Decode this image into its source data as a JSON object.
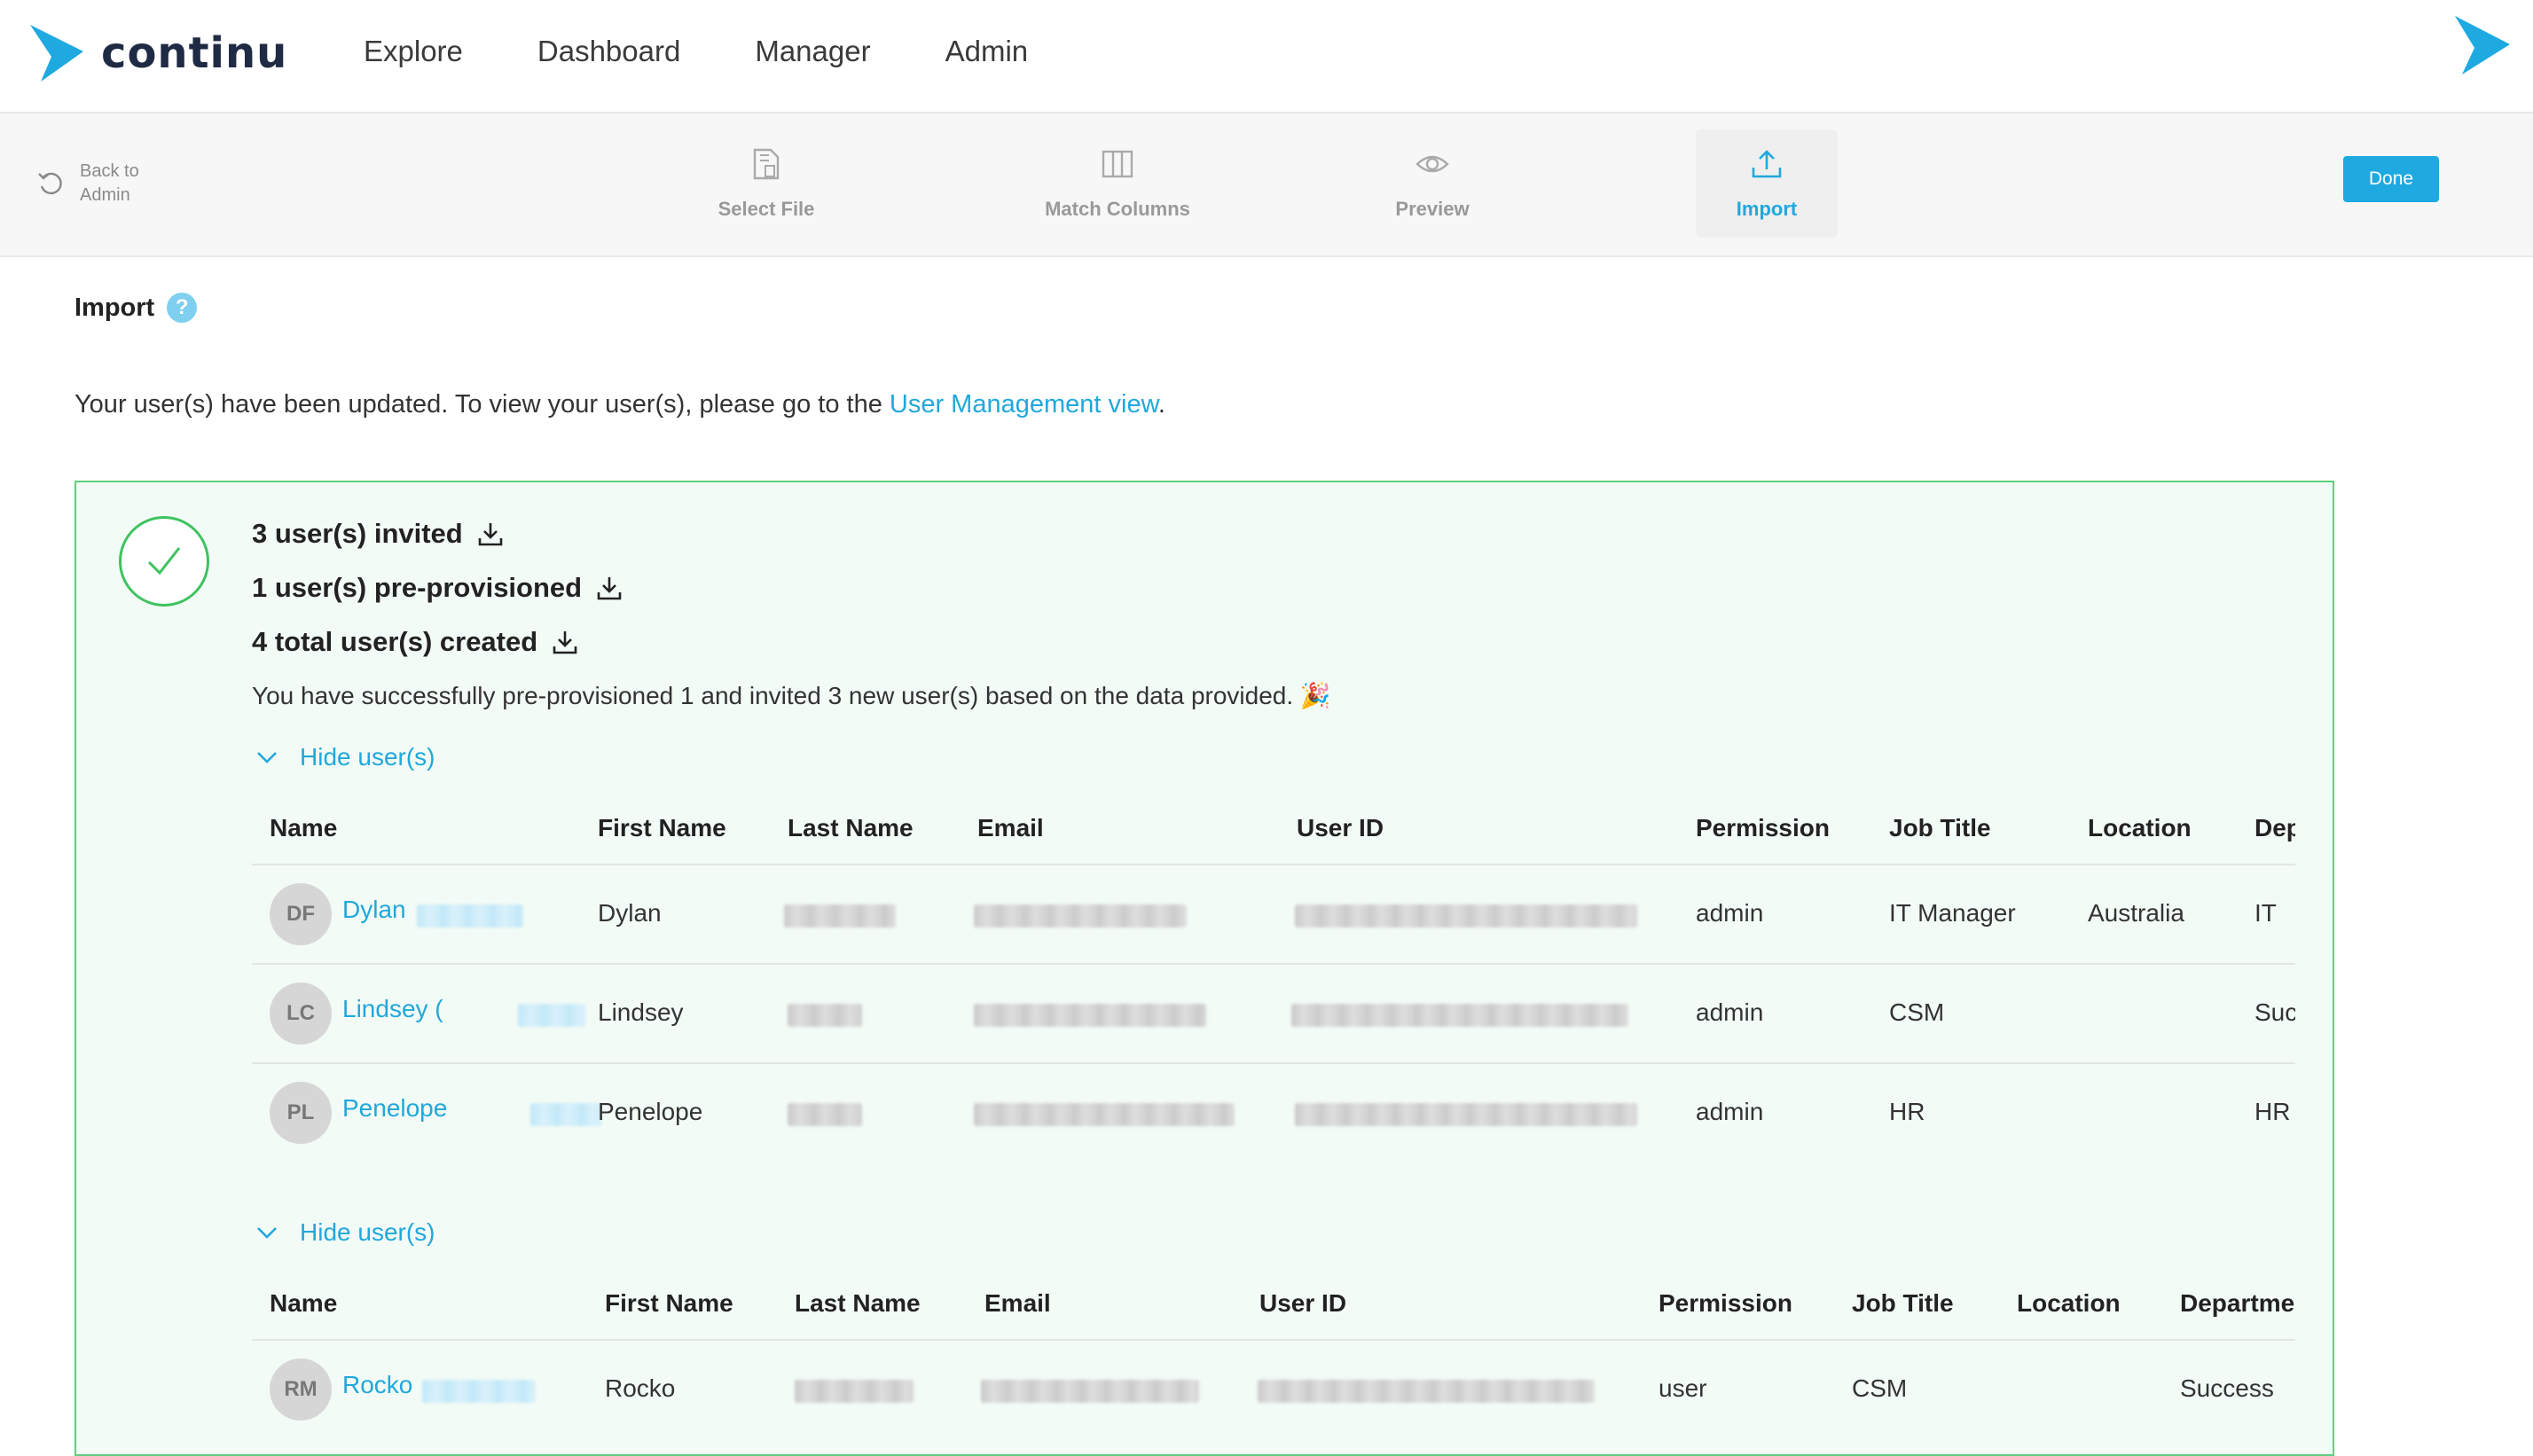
{
  "brand": {
    "name": "continu",
    "accent": "#1ea9e1"
  },
  "nav": {
    "items": [
      "Explore",
      "Dashboard",
      "Manager",
      "Admin"
    ]
  },
  "wizard": {
    "back_label": "Back to Admin",
    "steps": [
      {
        "label": "Select File",
        "icon": "file-icon"
      },
      {
        "label": "Match Columns",
        "icon": "columns-icon"
      },
      {
        "label": "Preview",
        "icon": "eye-icon"
      },
      {
        "label": "Import",
        "icon": "upload-icon",
        "active": true
      }
    ],
    "done_label": "Done"
  },
  "page": {
    "title": "Import",
    "help": "?",
    "info_prefix": "Your user(s) have been updated. To view your user(s), please go to the ",
    "info_link": "User Management view",
    "info_suffix": "."
  },
  "result": {
    "invited": "3 user(s) invited",
    "preprovisioned": "1 user(s) pre-provisioned",
    "total": "4 total user(s) created",
    "message": "You have successfully pre-provisioned 1 and invited 3 new user(s) based on the data provided. 🎉",
    "hide_label": "Hide user(s)"
  },
  "table1": {
    "columns": [
      "Name",
      "First Name",
      "Last Name",
      "Email",
      "User ID",
      "Permission",
      "Job Title",
      "Location",
      "Dep"
    ],
    "rows": [
      {
        "initials": "DF",
        "name": "Dylan",
        "first": "Dylan",
        "permission": "admin",
        "job": "IT Manager",
        "location": "Australia",
        "dept": "IT"
      },
      {
        "initials": "LC",
        "name": "Lindsey (",
        "first": "Lindsey",
        "permission": "admin",
        "job": "CSM",
        "location": "",
        "dept": "Suc"
      },
      {
        "initials": "PL",
        "name": "Penelope",
        "first": "Penelope",
        "permission": "admin",
        "job": "HR",
        "location": "",
        "dept": "HR"
      }
    ]
  },
  "table2": {
    "columns": [
      "Name",
      "First Name",
      "Last Name",
      "Email",
      "User ID",
      "Permission",
      "Job Title",
      "Location",
      "Departme"
    ],
    "rows": [
      {
        "initials": "RM",
        "name": "Rocko",
        "first": "Rocko",
        "permission": "user",
        "job": "CSM",
        "location": "",
        "dept": "Success"
      }
    ]
  }
}
